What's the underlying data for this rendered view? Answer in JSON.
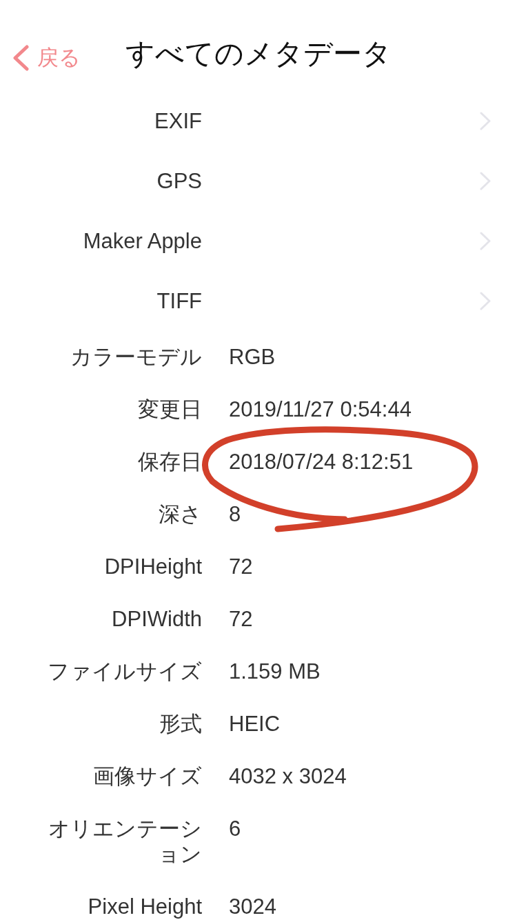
{
  "nav": {
    "back_label": "戻る",
    "title": "すべてのメタデータ"
  },
  "rows": [
    {
      "kind": "group",
      "label": "EXIF"
    },
    {
      "kind": "group",
      "label": "GPS"
    },
    {
      "kind": "group",
      "label": "Maker Apple"
    },
    {
      "kind": "group",
      "label": "TIFF"
    },
    {
      "kind": "field",
      "label": "カラーモデル",
      "value": "RGB"
    },
    {
      "kind": "field",
      "label": "変更日",
      "value": "2019/11/27 0:54:44"
    },
    {
      "kind": "field",
      "label": "保存日",
      "value": "2018/07/24 8:12:51"
    },
    {
      "kind": "field",
      "label": "深さ",
      "value": "8"
    },
    {
      "kind": "field",
      "label": "DPIHeight",
      "value": "72"
    },
    {
      "kind": "field",
      "label": "DPIWidth",
      "value": "72"
    },
    {
      "kind": "field",
      "label": "ファイルサイズ",
      "value": "1.159 MB"
    },
    {
      "kind": "field",
      "label": "形式",
      "value": "HEIC"
    },
    {
      "kind": "field",
      "label": "画像サイズ",
      "value": "4032 x 3024"
    },
    {
      "kind": "field",
      "label": "オリエンテーション",
      "value": "6"
    },
    {
      "kind": "field",
      "label": "Pixel Height",
      "value": "3024"
    }
  ]
}
